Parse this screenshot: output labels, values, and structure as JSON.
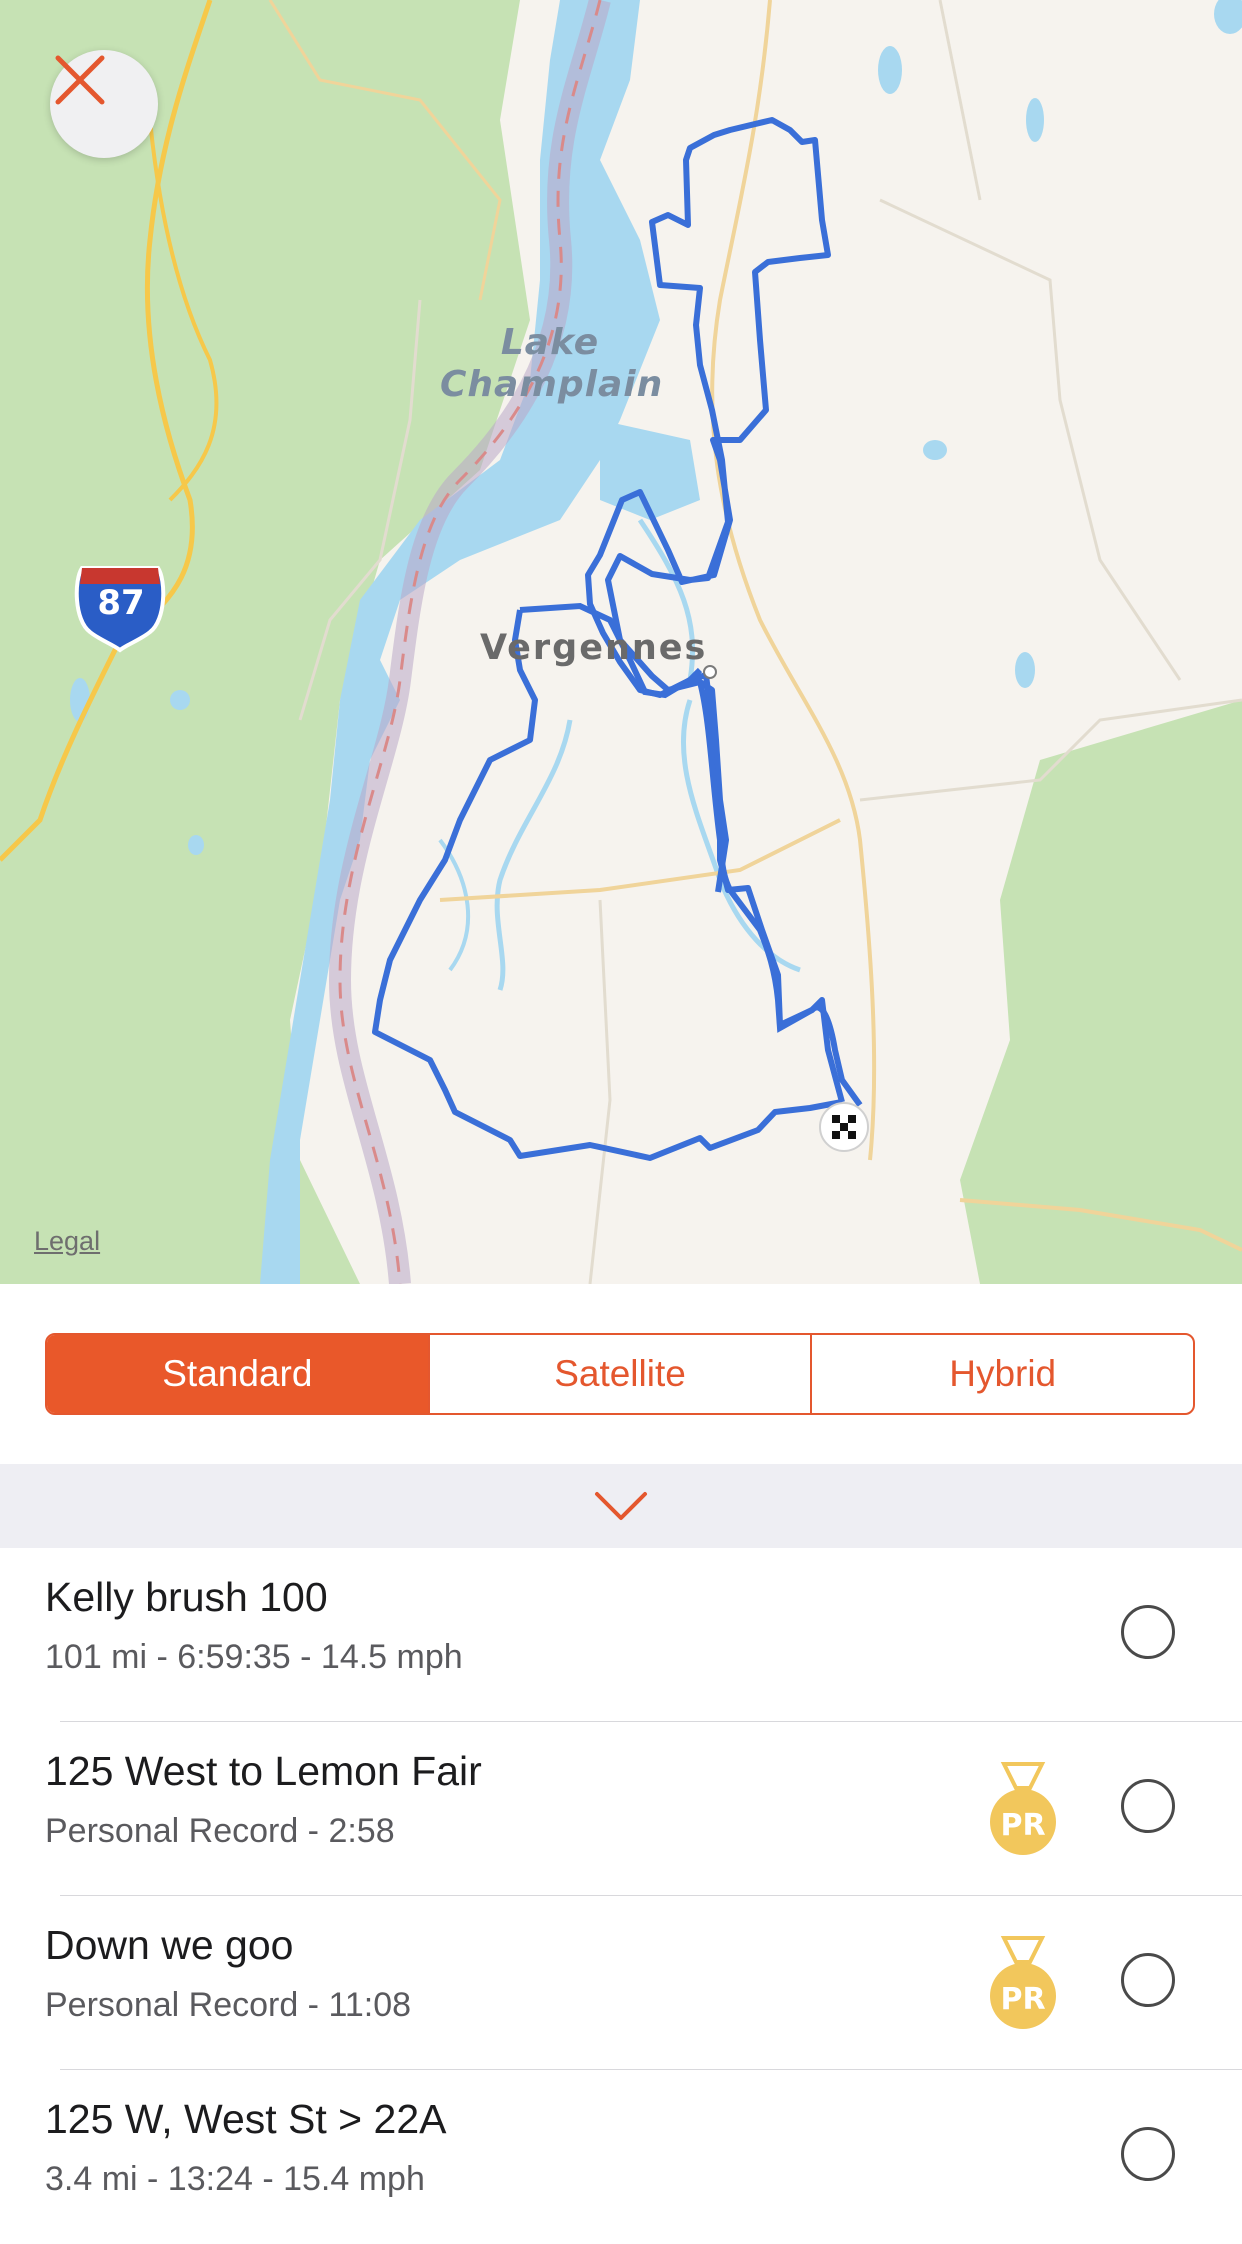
{
  "map": {
    "close_icon": "close-x-icon",
    "legal_label": "Legal",
    "lake_label_line1": "Lake",
    "lake_label_line2": "Champlain",
    "town_label": "Vergennes",
    "interstate_number": "87",
    "finish_icon": "checkered-flag-icon",
    "route_color": "#3a6fd8",
    "water_color": "#a8d8f0",
    "forest_color": "#c6e2b4"
  },
  "map_type": {
    "options": [
      "Standard",
      "Satellite",
      "Hybrid"
    ],
    "selected": "Standard",
    "accent_color": "#e9582a"
  },
  "collapse_icon": "chevron-down-icon",
  "segments": [
    {
      "title": "Kelly brush 100",
      "subtitle": "101 mi - 6:59:35 - 14.5 mph",
      "pr": false
    },
    {
      "title": "125 West to Lemon Fair",
      "subtitle": "Personal Record - 2:58",
      "pr": true
    },
    {
      "title": "Down we goo",
      "subtitle": "Personal Record - 11:08",
      "pr": true
    },
    {
      "title": "125 W, West St > 22A",
      "subtitle": "3.4 mi - 13:24 - 15.4 mph",
      "pr": false
    }
  ],
  "pr_badge_label": "PR"
}
